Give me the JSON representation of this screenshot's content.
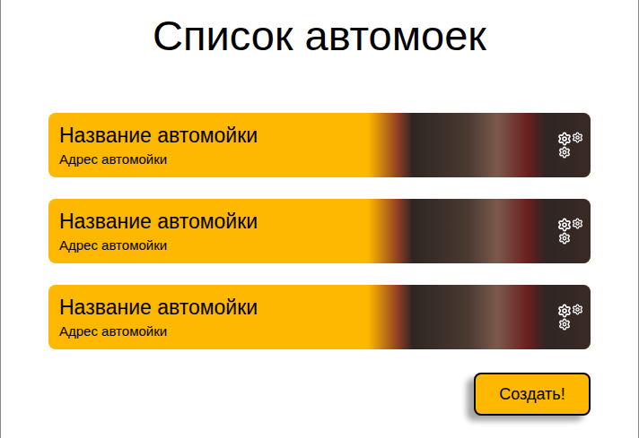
{
  "page": {
    "title": "Список автомоек"
  },
  "carwashes": [
    {
      "name": "Название автомойки",
      "address": "Адрес автомойки"
    },
    {
      "name": "Название автомойки",
      "address": "Адрес автомойки"
    },
    {
      "name": "Название автомойки",
      "address": "Адрес автомойки"
    }
  ],
  "buttons": [
    "Создать!"
  ]
}
